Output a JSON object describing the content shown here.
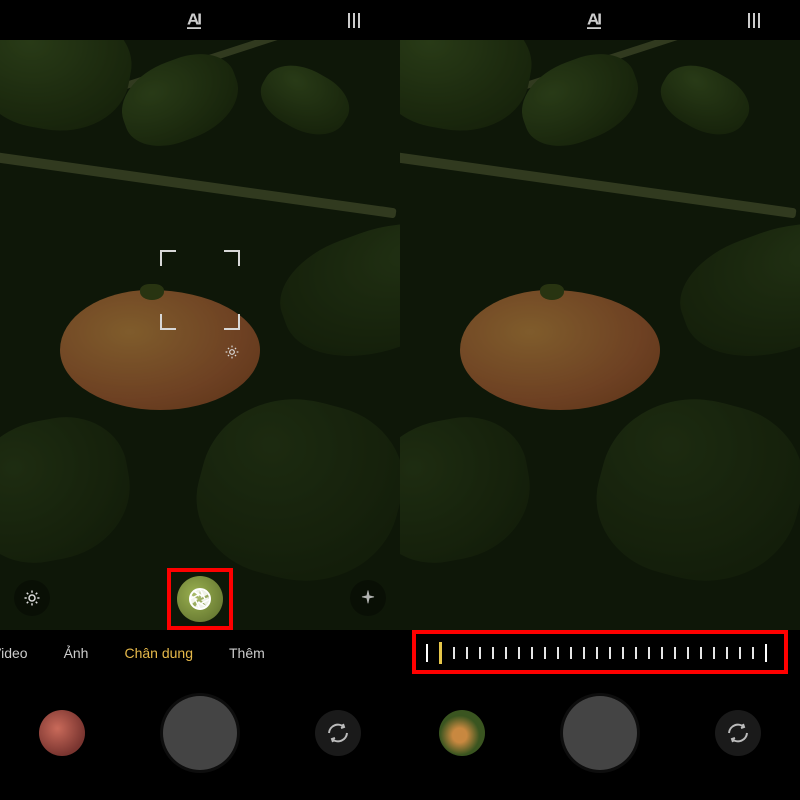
{
  "left": {
    "topbar": {
      "ai_label": "AI",
      "menu_label": "menu"
    },
    "focus": {
      "present": true
    },
    "vf_buttons": {
      "left_icon": "brightness-icon",
      "center_icon": "aperture-icon",
      "right_icon": "sparkle-icon"
    },
    "highlight": {
      "target": "aperture-button"
    },
    "modes": {
      "items": [
        {
          "label": "Video",
          "active": false,
          "cut": true
        },
        {
          "label": "Ảnh",
          "active": false
        },
        {
          "label": "Chân dung",
          "active": true
        },
        {
          "label": "Thêm",
          "active": false
        }
      ]
    },
    "controls": {
      "gallery": "gallery-thumbnail",
      "shutter": "shutter-button",
      "switch": "switch-camera"
    }
  },
  "right": {
    "topbar": {
      "ai_label": "AI",
      "menu_label": "menu"
    },
    "dial": {
      "ticks": 27,
      "cursor_index": 1
    },
    "highlight": {
      "target": "aperture-dial"
    },
    "controls": {
      "gallery": "gallery-thumbnail",
      "shutter": "shutter-button",
      "switch": "switch-camera"
    }
  },
  "colors": {
    "highlight": "#ff0000",
    "active_mode": "#e6b94a",
    "dial_cursor": "#e6c64a"
  }
}
